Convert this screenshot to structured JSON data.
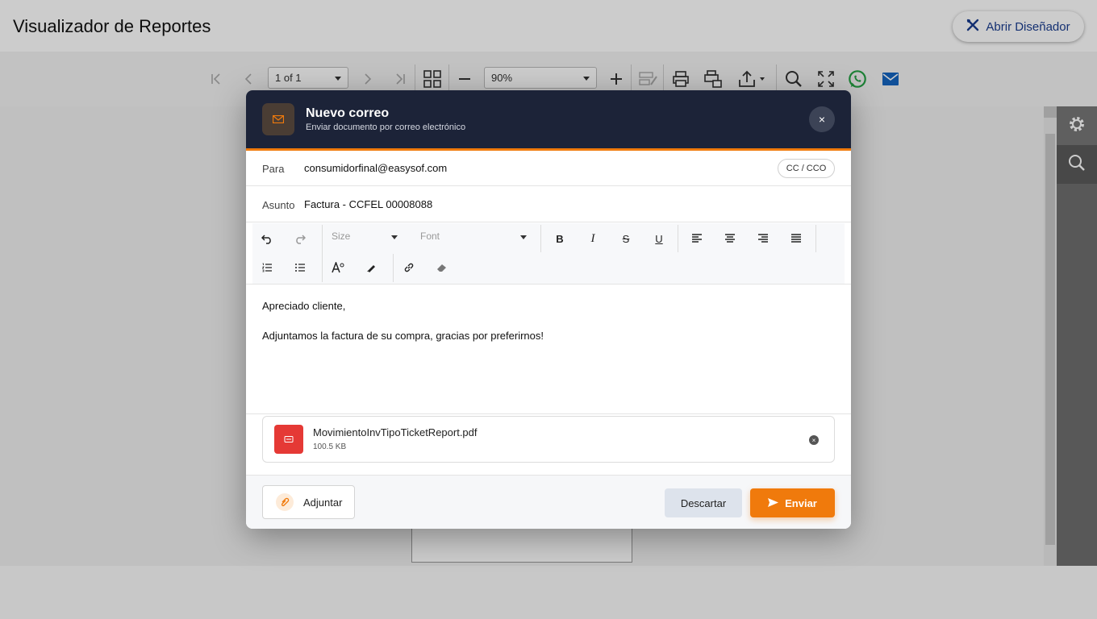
{
  "app": {
    "title": "Visualizador de Reportes",
    "designer_button": "Abrir Diseñador"
  },
  "toolbar": {
    "page_select": "1 of 1",
    "zoom_select": "90%",
    "icons": [
      "first-page-icon",
      "prev-page-icon",
      "next-page-icon",
      "last-page-icon",
      "multipage-icon",
      "zoom-out-icon",
      "zoom-in-icon",
      "edit-icon",
      "print-icon",
      "print-preview-icon",
      "export-icon",
      "search-icon",
      "fullscreen-icon",
      "whatsapp-icon",
      "email-icon"
    ]
  },
  "side_panel": {
    "icons": [
      "gear-icon",
      "search-icon"
    ]
  },
  "email": {
    "title": "Nuevo correo",
    "subtitle": "Enviar documento por correo electrónico",
    "close_label": "×",
    "to_label": "Para",
    "to_value": "consumidorfinal@easysof.com",
    "cc_button": "CC / CCO",
    "subject_label": "Asunto",
    "subject_value": "Factura - CCFEL 00008088",
    "editor": {
      "size_placeholder": "Size",
      "font_placeholder": "Font",
      "bold": "B",
      "italic": "I",
      "strike": "S",
      "underline": "U"
    },
    "body_lines": [
      "Apreciado cliente,",
      "Adjuntamos la factura de su compra, gracias por preferirnos!"
    ],
    "attachment": {
      "name": "MovimientoInvTipoTicketReport.pdf",
      "size": "100.5 KB"
    },
    "attach_button": "Adjuntar",
    "discard_button": "Descartar",
    "send_button": "Enviar"
  },
  "colors": {
    "header_dark": "#1c2338",
    "accent_orange": "#f07a0c",
    "pdf_red": "#e53935",
    "brand_blue": "#1a3d8f",
    "whatsapp_green": "#25a244"
  }
}
